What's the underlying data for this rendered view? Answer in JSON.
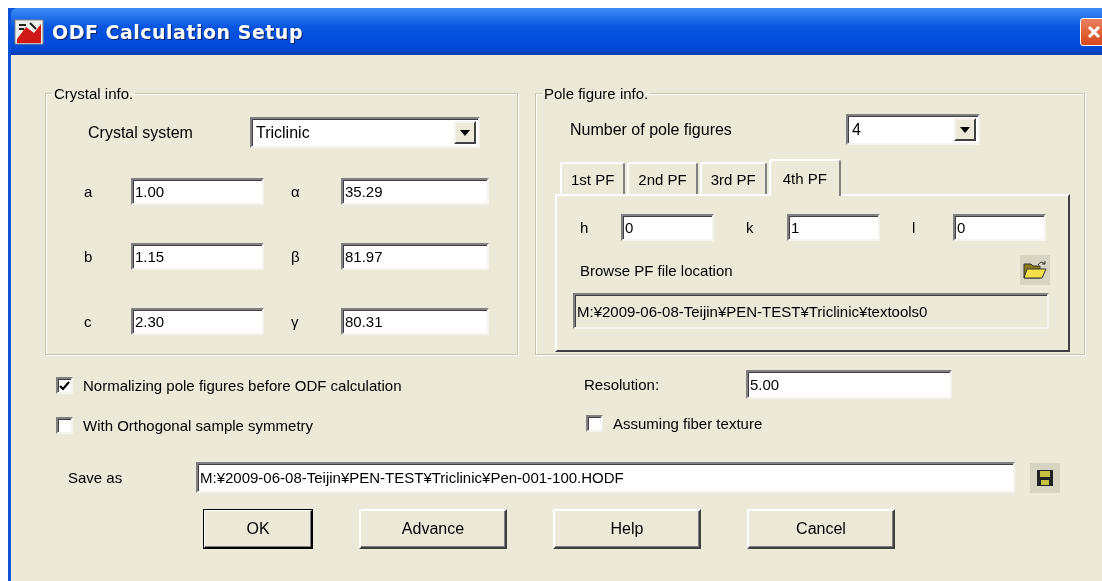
{
  "window": {
    "title": "ODF Calculation Setup"
  },
  "crystal_info": {
    "title": "Crystal info.",
    "crystal_system": {
      "label": "Crystal system",
      "value": "Triclinic"
    },
    "parameters": [
      {
        "label": "a",
        "value": "1.00"
      },
      {
        "label": "α",
        "value": "35.29"
      },
      {
        "label": "b",
        "value": "1.15"
      },
      {
        "label": "β",
        "value": "81.97"
      },
      {
        "label": "c",
        "value": "2.30"
      },
      {
        "label": "γ",
        "value": "80.31"
      }
    ]
  },
  "pole_figure_info": {
    "title": "Pole figure info.",
    "number_of_pole_figures": {
      "label": "Number of pole figures",
      "value": "4"
    },
    "tabs": [
      {
        "label": "1st PF",
        "selected": false
      },
      {
        "label": "2nd PF",
        "selected": false
      },
      {
        "label": "3rd PF",
        "selected": false
      },
      {
        "label": "4th PF",
        "selected": true
      }
    ],
    "indices": [
      {
        "label": "h",
        "value": "0"
      },
      {
        "label": "k",
        "value": "1"
      },
      {
        "label": "l",
        "value": "0"
      }
    ],
    "browse_label": "Browse PF file location",
    "file_path": "M:¥2009-06-08-Teijin¥PEN-TEST¥Triclinic¥textools0"
  },
  "options": [
    {
      "label": "Normalizing pole figures before ODF calculation",
      "checked": true
    },
    {
      "label": "With Orthogonal sample symmetry",
      "checked": false
    }
  ],
  "resolution": {
    "label": "Resolution:",
    "value": "5.00"
  },
  "fiber_texture": {
    "label": "Assuming fiber texture",
    "checked": false
  },
  "save_as": {
    "label": "Save as",
    "value": "M:¥2009-06-08-Teijin¥PEN-TEST¥Triclinic¥Pen-001-100.HODF"
  },
  "buttons": [
    {
      "label": "OK",
      "default": true
    },
    {
      "label": "Advance",
      "default": false
    },
    {
      "label": "Help",
      "default": false
    },
    {
      "label": "Cancel",
      "default": false
    }
  ]
}
